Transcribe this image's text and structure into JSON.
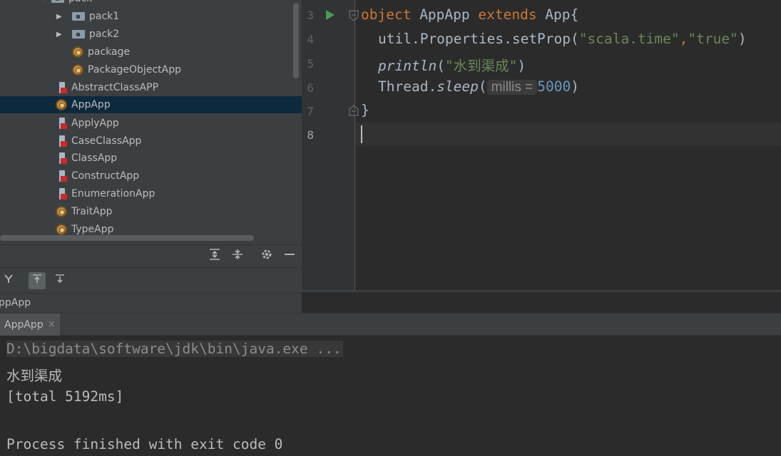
{
  "tree": {
    "top_partial_label": "pack",
    "items": [
      {
        "label": "pack1",
        "icon": "folder-icon",
        "expandable": true
      },
      {
        "label": "pack2",
        "icon": "folder-icon",
        "expandable": true
      },
      {
        "label": "package",
        "icon": "scala-object-icon"
      },
      {
        "label": "PackageObjectApp",
        "icon": "scala-object-icon"
      },
      {
        "label": "AbstractClassAPP",
        "icon": "scala-class-icon"
      },
      {
        "label": "AppApp",
        "icon": "scala-object-icon",
        "selected": true
      },
      {
        "label": "ApplyApp",
        "icon": "scala-class-icon"
      },
      {
        "label": "CaseClassApp",
        "icon": "scala-class-icon"
      },
      {
        "label": "ClassApp",
        "icon": "scala-class-icon"
      },
      {
        "label": "ConstructApp",
        "icon": "scala-class-icon"
      },
      {
        "label": "EnumerationApp",
        "icon": "scala-class-icon"
      },
      {
        "label": "TraitApp",
        "icon": "scala-object-icon"
      },
      {
        "label": "TypeApp",
        "icon": "scala-object-icon"
      }
    ]
  },
  "panel": {
    "toolbar_icons": [
      "expand-all-icon",
      "collapse-all-icon",
      "gear-icon",
      "minimize-icon"
    ],
    "breadcrumb": "ppApp"
  },
  "editor": {
    "line_numbers": [
      "3",
      "4",
      "5",
      "6",
      "7",
      "8"
    ],
    "line3": {
      "kw1": "object",
      "name": " AppApp ",
      "kw2": "extends",
      "rest": " App{"
    },
    "line4": {
      "pre": "util.Properties.setProp(",
      "s1": "\"scala.time\"",
      "comma": ",",
      "s2": "\"true\"",
      "post": ")"
    },
    "line5": {
      "fn": "println",
      "open": "(",
      "s": "\"水到渠成\"",
      "close": ")"
    },
    "line6": {
      "pre": "Thread.",
      "fn": "sleep",
      "open": "(",
      "hint": "millis =",
      "num": "5000",
      "close": ")"
    },
    "line7": "}",
    "line8": ""
  },
  "run": {
    "tab_label": "AppApp",
    "tab_close": "×",
    "console": [
      "D:\\bigdata\\software\\jdk\\bin\\java.exe ...",
      "水到渠成",
      "[total 5192ms]",
      "",
      "Process finished with exit code 0"
    ]
  },
  "colors": {
    "keyword": "#cc7832",
    "string": "#6a8759",
    "number": "#6897bb",
    "selection": "#0d293e"
  }
}
